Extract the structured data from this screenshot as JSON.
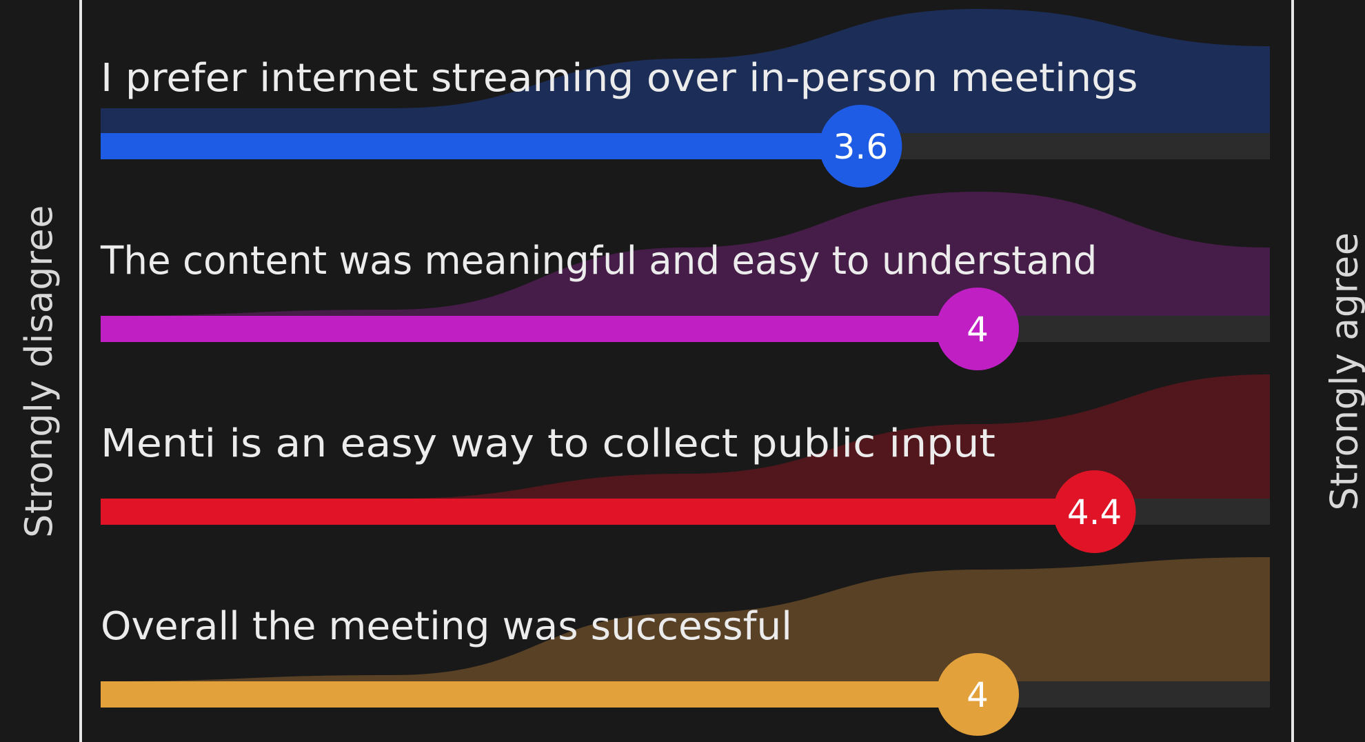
{
  "chart_data": {
    "type": "scale",
    "scale_min": 1,
    "scale_max": 5,
    "scale_min_label": "Strongly disagree",
    "scale_max_label": "Strongly agree",
    "statements": [
      {
        "label": "I prefer internet streaming over in-person meetings",
        "value": 3.6,
        "value_label": "3.6",
        "color": "#1f5ce6",
        "shade": "#1c2d58",
        "distribution": [
          0.2,
          0.2,
          0.6,
          1.0,
          0.7
        ]
      },
      {
        "label": "The content was meaningful and easy to understand",
        "value": 4,
        "value_label": "4",
        "color": "#c01fc4",
        "shade": "#461c48",
        "distribution": [
          0.0,
          0.05,
          0.55,
          1.0,
          0.55
        ]
      },
      {
        "label": "Menti is an easy way to collect public input",
        "value": 4.4,
        "value_label": "4.4",
        "color": "#e01426",
        "shade": "#52171c",
        "distribution": [
          0.0,
          0.0,
          0.2,
          0.6,
          1.0
        ]
      },
      {
        "label": "Overall the meeting was successful",
        "value": 4,
        "value_label": "4",
        "color": "#e3a13b",
        "shade": "#594126",
        "distribution": [
          0.0,
          0.05,
          0.55,
          0.9,
          1.0
        ]
      }
    ]
  }
}
